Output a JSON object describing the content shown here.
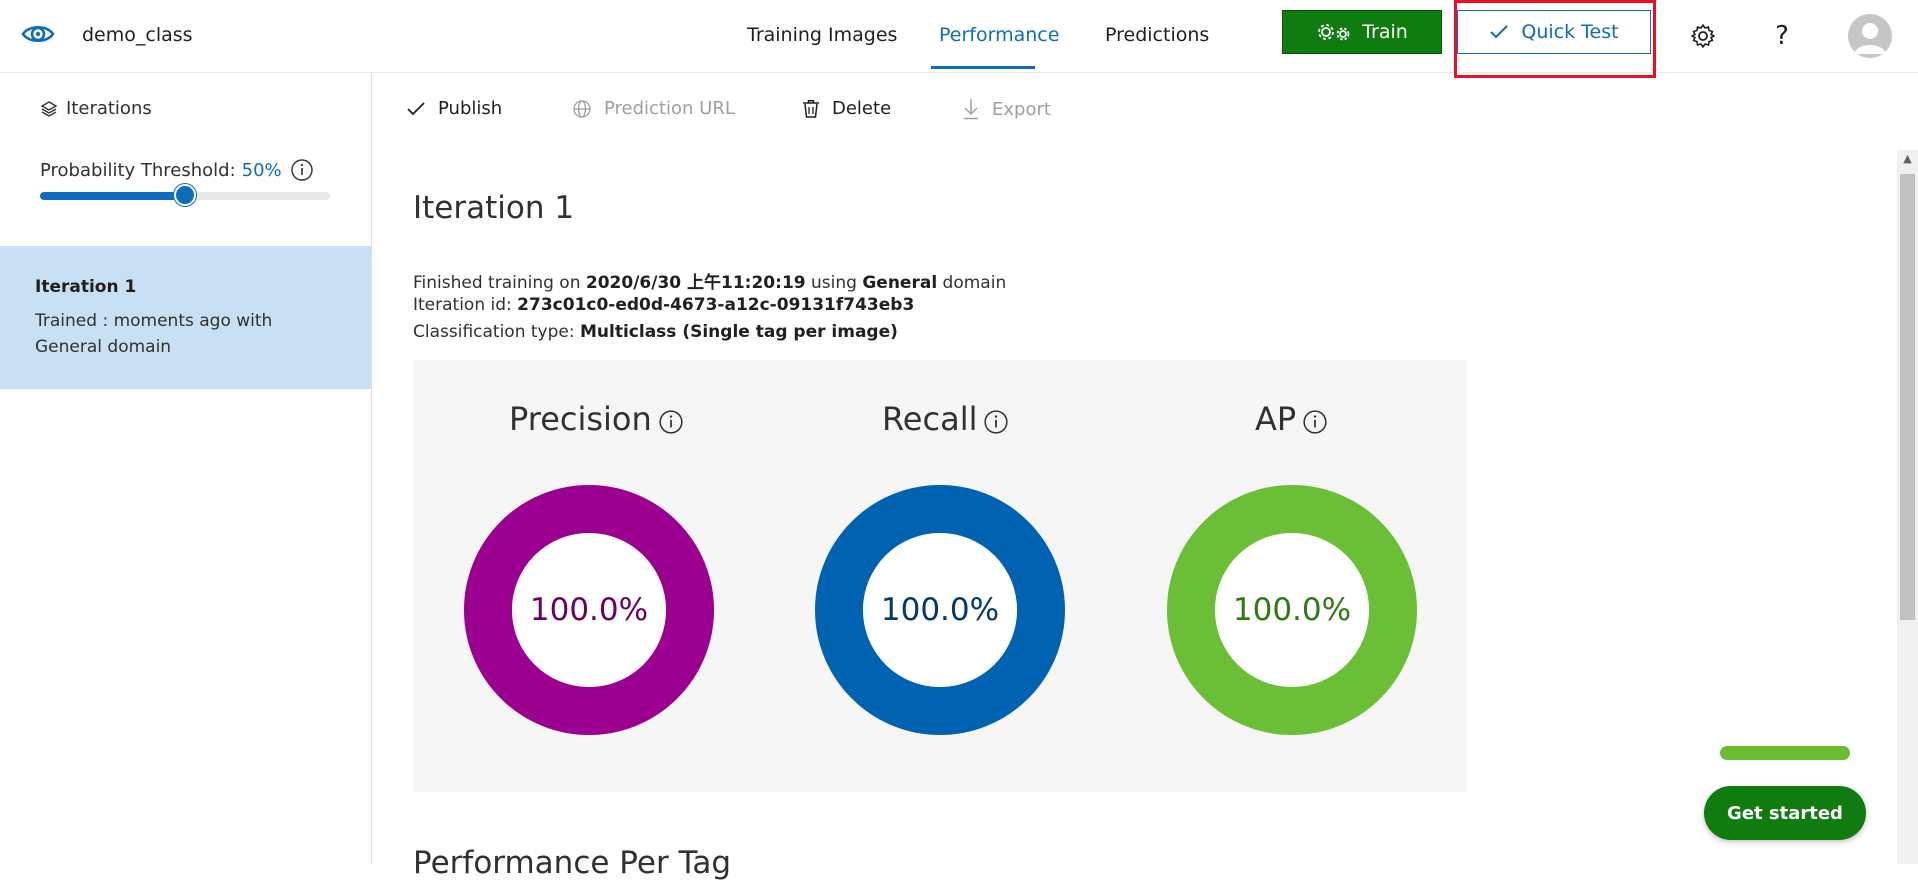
{
  "header": {
    "project_name": "demo_class",
    "tabs": [
      {
        "label": "Training Images",
        "active": false
      },
      {
        "label": "Performance",
        "active": true
      },
      {
        "label": "Predictions",
        "active": false
      }
    ],
    "train_label": "Train",
    "quick_test_label": "Quick Test",
    "help_label": "?"
  },
  "sidebar": {
    "iterations_label": "Iterations",
    "threshold_label": "Probability Threshold:",
    "threshold_value": "50%",
    "threshold_fraction": 0.5,
    "iteration": {
      "title": "Iteration 1",
      "description": "Trained : moments ago with General domain"
    }
  },
  "toolbar": {
    "publish": "Publish",
    "prediction_url": "Prediction URL",
    "delete": "Delete",
    "export": "Export"
  },
  "main": {
    "heading": "Iteration 1",
    "finished_prefix": "Finished training on ",
    "finished_date": "2020/6/30 上午11:20:19",
    "finished_mid": " using ",
    "finished_domain": "General",
    "finished_suffix": " domain",
    "iteration_id_label": "Iteration id: ",
    "iteration_id": "273c01c0-ed0d-4673-a12c-09131f743eb3",
    "classification_label": "Classification type: ",
    "classification_type": "Multiclass (Single tag per image)",
    "metrics": [
      {
        "title": "Precision",
        "value": "100.0%",
        "fraction": 1.0,
        "color": "#9b0091",
        "text_color": "#6b0063"
      },
      {
        "title": "Recall",
        "value": "100.0%",
        "fraction": 1.0,
        "color": "#0063b1",
        "text_color": "#003a6b"
      },
      {
        "title": "AP",
        "value": "100.0%",
        "fraction": 1.0,
        "color": "#6bbf36",
        "text_color": "#2d7a11"
      }
    ],
    "per_tag_heading": "Performance Per Tag"
  },
  "get_started": {
    "label": "Get started"
  },
  "colors": {
    "accent": "#0f6cbd",
    "train_green": "#107c10",
    "highlight_red": "#e81123",
    "selected_iteration_bg": "#c7e0f4"
  }
}
